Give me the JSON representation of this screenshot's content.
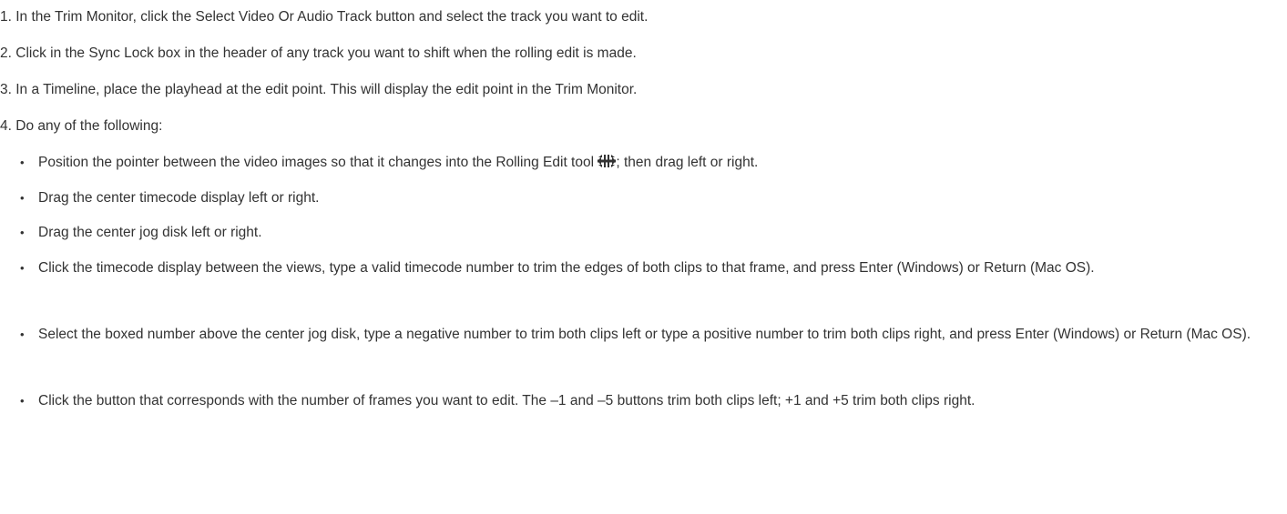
{
  "steps": [
    {
      "number": "1.",
      "text": "In the Trim Monitor, click the Select Video Or Audio Track button and select the track you want to edit."
    },
    {
      "number": "2.",
      "text": "Click in the Sync Lock box in the header of any track you want to shift when the rolling edit is made."
    },
    {
      "number": "3.",
      "text": "In a Timeline, place the playhead at the edit point. This will display the edit point in the Trim Monitor."
    },
    {
      "number": "4.",
      "text": "Do any of the following:"
    }
  ],
  "sub_items": [
    {
      "bullet": "•",
      "text_before": "Position the pointer between the video images so that it changes into the Rolling Edit tool",
      "icon": "rolling-edit-tool-icon",
      "text_after": "; then drag left or right."
    },
    {
      "bullet": "•",
      "text": "Drag the center timecode display left or right."
    },
    {
      "bullet": "•",
      "text": "Drag the center jog disk left or right."
    },
    {
      "bullet": "•",
      "text": "Click the timecode display between the views, type a valid timecode number to trim the edges of both clips to that frame, and press Enter (Windows) or Return (Mac OS)."
    },
    {
      "bullet": "•",
      "text": "Select the boxed number above the center jog disk, type a negative number to trim both clips left or type a positive number to trim both clips right, and press Enter (Windows) or Return (Mac OS)."
    },
    {
      "bullet": "•",
      "text": "Click the button that corresponds with the number of frames you want to edit. The –1 and –5 buttons trim both clips left; +1 and +5 trim both clips right."
    }
  ],
  "colors": {
    "text": "#333333",
    "background": "#ffffff"
  }
}
